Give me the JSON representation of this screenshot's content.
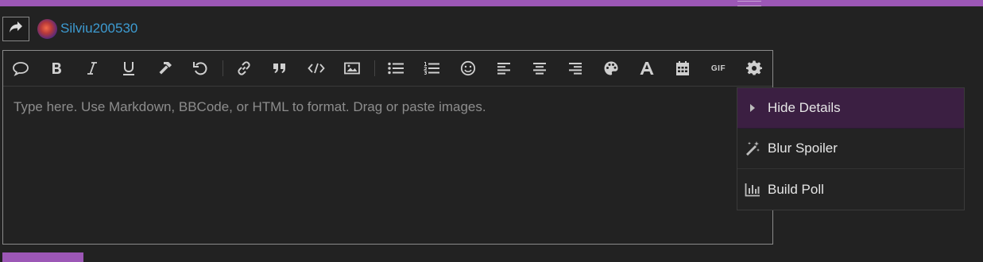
{
  "header": {
    "accent_color": "#9c57b6"
  },
  "post": {
    "username": "Silviu200530",
    "username_color": "#3d9bd1"
  },
  "toolbar": {
    "buttons": [
      {
        "icon": "speech-bubble-icon",
        "title": "Quote"
      },
      {
        "icon": "bold-icon",
        "title": "Bold"
      },
      {
        "icon": "italic-icon",
        "title": "Italic"
      },
      {
        "icon": "underline-icon",
        "title": "Underline"
      },
      {
        "icon": "hammer-icon",
        "title": "Format"
      },
      {
        "icon": "undo-icon",
        "title": "Undo"
      },
      {
        "icon": "link-icon",
        "title": "Link"
      },
      {
        "icon": "blockquote-icon",
        "title": "Blockquote"
      },
      {
        "icon": "code-icon",
        "title": "Code"
      },
      {
        "icon": "image-icon",
        "title": "Image"
      },
      {
        "icon": "bullet-list-icon",
        "title": "Bulleted list"
      },
      {
        "icon": "numbered-list-icon",
        "title": "Numbered list"
      },
      {
        "icon": "emoji-icon",
        "title": "Emoji"
      },
      {
        "icon": "align-left-icon",
        "title": "Align left"
      },
      {
        "icon": "align-center-icon",
        "title": "Align center"
      },
      {
        "icon": "align-right-icon",
        "title": "Align right"
      },
      {
        "icon": "palette-icon",
        "title": "Color"
      },
      {
        "icon": "font-icon",
        "title": "Font"
      },
      {
        "icon": "calendar-icon",
        "title": "Date"
      },
      {
        "icon": "gif-icon",
        "title": "GIF"
      },
      {
        "icon": "gear-icon",
        "title": "Options"
      }
    ],
    "gif_label": "GIF"
  },
  "editor": {
    "placeholder": "Type here. Use Markdown, BBCode, or HTML to format. Drag or paste images.",
    "value": ""
  },
  "dropdown": {
    "items": [
      {
        "label": "Hide Details",
        "icon": "caret-right-icon",
        "active": true
      },
      {
        "label": "Blur Spoiler",
        "icon": "magic-wand-icon",
        "active": false
      },
      {
        "label": "Build Poll",
        "icon": "bar-chart-icon",
        "active": false
      }
    ]
  }
}
